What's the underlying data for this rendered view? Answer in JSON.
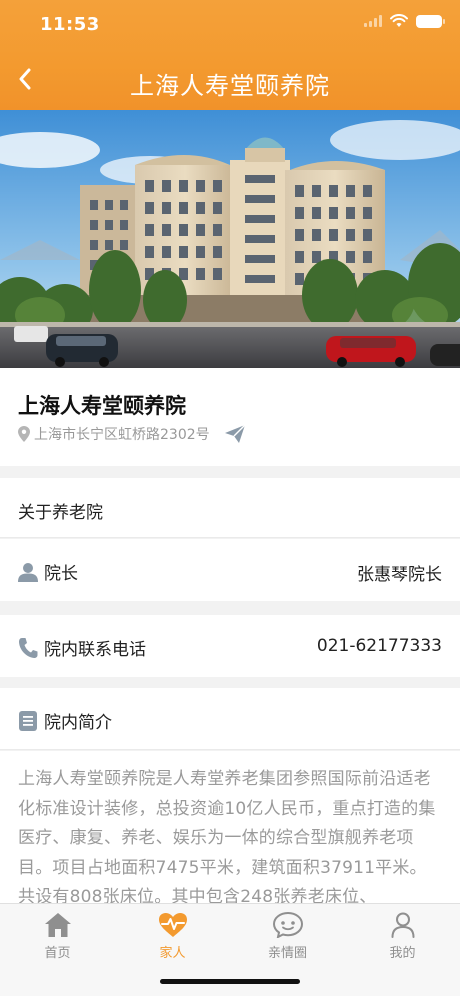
{
  "status_bar": {
    "time": "11:53"
  },
  "nav": {
    "title": "上海人寿堂颐养院"
  },
  "institution": {
    "name": "上海人寿堂颐养院",
    "address": "上海市长宁区虹桥路2302号"
  },
  "about": {
    "label": "关于养老院"
  },
  "director": {
    "label": "院长",
    "value": "张惠琴院长"
  },
  "phone": {
    "label": "院内联系电话",
    "value": "021-62177333"
  },
  "intro": {
    "label": "院内简介",
    "text": "上海人寿堂颐养院是人寿堂养老集团参照国际前沿适老化标准设计装修，总投资逾10亿人民币，重点打造的集医疗、康复、养老、娱乐为一体的综合型旗舰养老项目。项目占地面积7475平米，建筑面积37911平米。共设有808张床位。其中包含248张养老床位、"
  },
  "tabs": [
    {
      "label": "首页",
      "icon": "home-icon",
      "active": false
    },
    {
      "label": "家人",
      "icon": "heartbeat-icon",
      "active": true
    },
    {
      "label": "亲情圈",
      "icon": "chat-face-icon",
      "active": false
    },
    {
      "label": "我的",
      "icon": "user-icon",
      "active": false
    }
  ],
  "colors": {
    "accent": "#f39a2f",
    "header_gradient_top": "#f4a13a",
    "muted_text": "#9a9a9a"
  }
}
